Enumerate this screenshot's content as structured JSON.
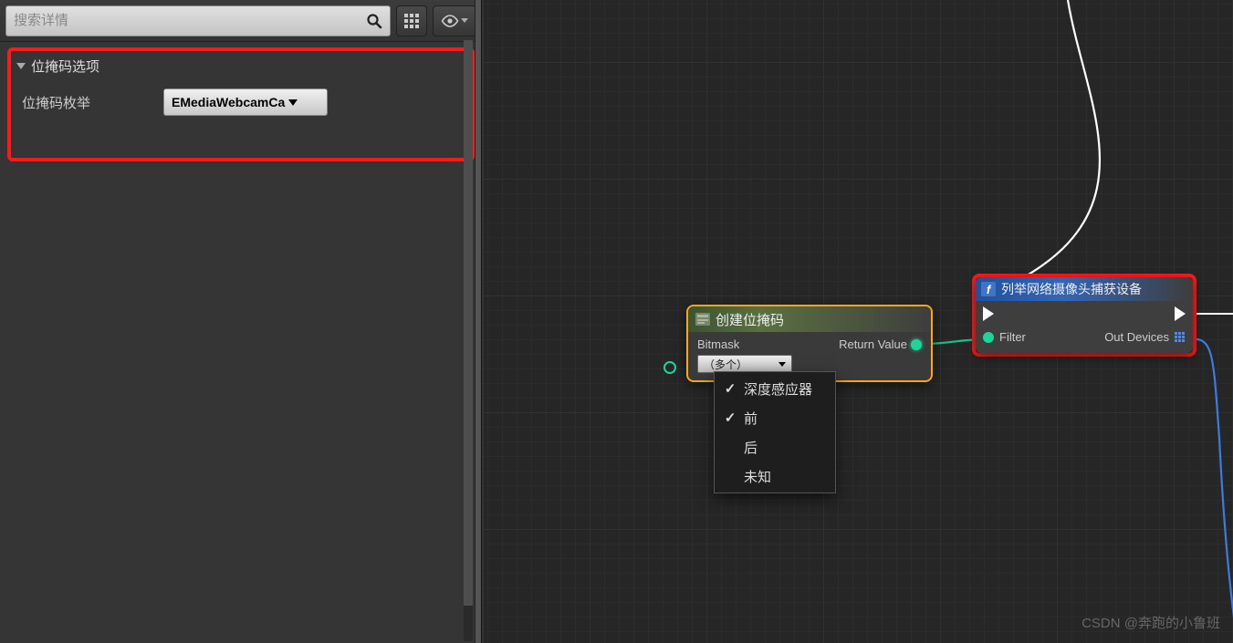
{
  "panel": {
    "search_placeholder": "搜索详情",
    "section_title": "位掩码选项",
    "row_label": "位掩码枚举",
    "dropdown_value": "EMediaWebcamCa"
  },
  "node1": {
    "title": "创建位掩码",
    "in_label": "Bitmask",
    "out_label": "Return Value",
    "dd_value": "（多个）"
  },
  "menu": {
    "items": [
      {
        "label": "深度感应器",
        "checked": true
      },
      {
        "label": "前",
        "checked": true
      },
      {
        "label": "后",
        "checked": false
      },
      {
        "label": "未知",
        "checked": false
      }
    ]
  },
  "node2": {
    "title": "列举网络摄像头捕获设备",
    "in_label": "Filter",
    "out_label": "Out Devices"
  },
  "watermark": "CSDN @奔跑的小鲁班"
}
